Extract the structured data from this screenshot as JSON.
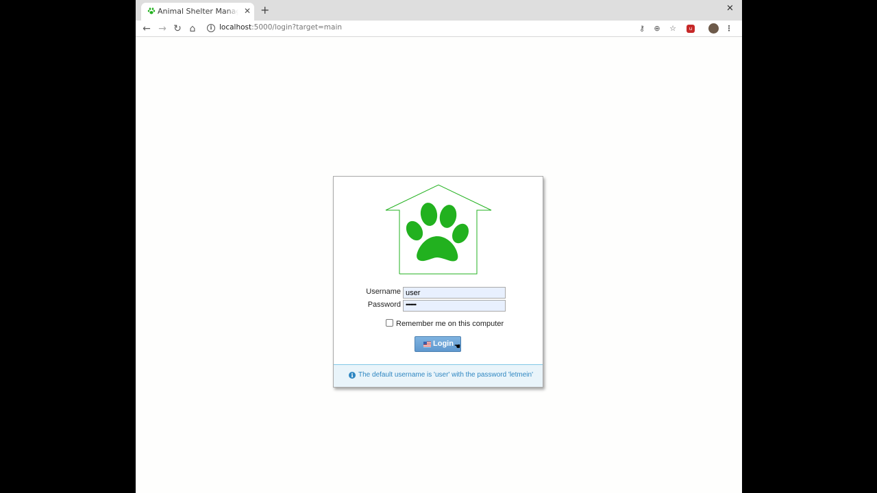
{
  "browser": {
    "tab_title": "Animal Shelter Manager Login",
    "new_tab_label": "+",
    "close_tab_glyph": "✕",
    "close_window_glyph": "✕",
    "url_host": "localhost",
    "url_rest": ":5000/login?target=main"
  },
  "login": {
    "username_label": "Username",
    "username_value": "user",
    "password_label": "Password",
    "password_value": "•••••••",
    "remember_label": "Remember me on this computer",
    "login_button": "Login",
    "notice": "The default username is 'user' with the password 'letmein'"
  },
  "colors": {
    "brand_green": "#22b11f",
    "button_blue": "#6fa6d8",
    "notice_blue": "#2e86c1"
  }
}
